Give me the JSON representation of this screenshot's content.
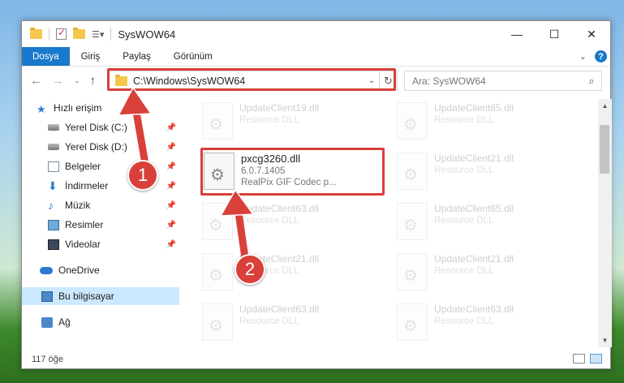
{
  "window": {
    "title": "SysWOW64"
  },
  "ribbon": {
    "tabs": [
      "Dosya",
      "Giriş",
      "Paylaş",
      "Görünüm"
    ]
  },
  "address": {
    "path": "C:\\Windows\\SysWOW64"
  },
  "search": {
    "placeholder": "Ara: SysWOW64"
  },
  "sidebar": {
    "quick_access": "Hızlı erişim",
    "items": [
      {
        "label": "Yerel Disk (C:)",
        "icon": "disk-icon",
        "pinned": true
      },
      {
        "label": "Yerel Disk (D:)",
        "icon": "disk-icon",
        "pinned": true
      },
      {
        "label": "Belgeler",
        "icon": "documents-icon",
        "pinned": true
      },
      {
        "label": "İndirmeler",
        "icon": "downloads-icon",
        "pinned": true
      },
      {
        "label": "Müzik",
        "icon": "music-icon",
        "pinned": true
      },
      {
        "label": "Resimler",
        "icon": "pictures-icon",
        "pinned": true
      },
      {
        "label": "Videolar",
        "icon": "videos-icon",
        "pinned": true
      }
    ],
    "onedrive": "OneDrive",
    "this_pc": "Bu bilgisayar",
    "network": "Ağ"
  },
  "files": {
    "left": [
      {
        "name": "UpdateClient19.dll",
        "desc": "Resource DLL"
      },
      {
        "name": "UpdateClient63.dll",
        "desc": "Resource DLL"
      },
      {
        "name": "UpdateClient21.dll",
        "desc": "Resource DLL"
      },
      {
        "name": "UpdateClient63.dll",
        "desc": "Resource DLL"
      }
    ],
    "right": [
      {
        "name": "UpdateClient65.dll",
        "desc": "Resource DLL"
      },
      {
        "name": "UpdateClient21.dll",
        "desc": "Resource DLL"
      },
      {
        "name": "UpdateClient65.dll",
        "desc": "Resource DLL"
      },
      {
        "name": "UpdateClient21.dll",
        "desc": "Resource DLL"
      },
      {
        "name": "UpdateClient63.dll",
        "desc": "Resource DLL"
      }
    ],
    "highlighted": {
      "name": "pxcg3260.dll",
      "version": "6.0.7.1405",
      "desc": "RealPix GIF Codec p..."
    }
  },
  "status": {
    "count": "117 öğe"
  },
  "annotations": {
    "step1": "1",
    "step2": "2",
    "color": "#d9403a"
  }
}
